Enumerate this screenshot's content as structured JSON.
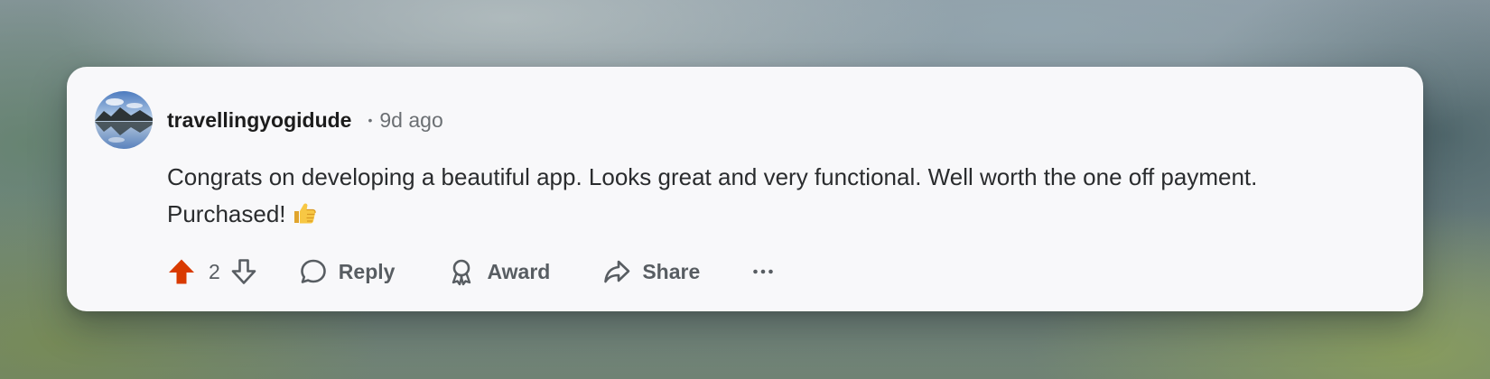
{
  "comment": {
    "author": "travellingyogidude",
    "separator": "•",
    "timestamp": "9d ago",
    "body_line1": "Congrats on developing a beautiful app. Looks great and very functional. Well worth the one off payment.",
    "body_line2": "Purchased!",
    "emoji": "thumbs-up-emoji",
    "votes": "2",
    "upvoted": true
  },
  "actions": {
    "reply_label": "Reply",
    "award_label": "Award",
    "share_label": "Share"
  },
  "icons": {
    "upvote": "arrow-up-filled-icon",
    "downvote": "arrow-down-outline-icon",
    "reply": "speech-bubble-icon",
    "award": "award-ribbon-icon",
    "share": "share-arrow-icon",
    "more": "ellipsis-icon"
  },
  "colors": {
    "upvote_active": "#d93a00",
    "action_text": "#585d62",
    "card_background": "#f8f8fa"
  }
}
